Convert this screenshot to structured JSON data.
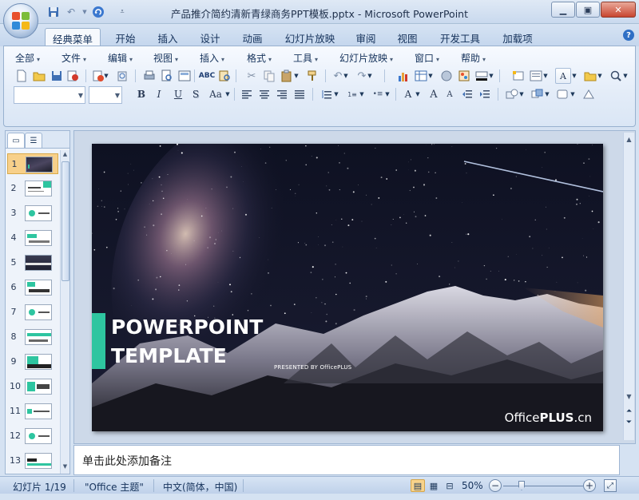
{
  "window": {
    "title": "产品推介简约清新青绿商务PPT模板.pptx - Microsoft PowerPoint",
    "minimize_icon": "minimize-icon",
    "maximize_icon": "maximize-icon",
    "close_icon": "close-icon"
  },
  "quick_access": {
    "save_icon": "save-icon",
    "undo_icon": "undo-icon",
    "redo_icon": "redo-icon",
    "customize_icon": "chevron-down-icon"
  },
  "ribbon_tabs": [
    "经典菜单",
    "开始",
    "插入",
    "设计",
    "动画",
    "幻灯片放映",
    "审阅",
    "视图",
    "开发工具",
    "加载项"
  ],
  "active_tab": "经典菜单",
  "menu_row": [
    "全部",
    "文件",
    "编辑",
    "视图",
    "插入",
    "格式",
    "工具",
    "幻灯片放映",
    "窗口",
    "帮助"
  ],
  "format_labels": {
    "bold": "B",
    "italic": "I",
    "underline": "U",
    "shadow": "S",
    "change_case": "Aa",
    "font_color": "A",
    "grow_font": "A",
    "shrink_font": "A",
    "text_box": "A"
  },
  "slides_pane": {
    "slide_numbers": [
      "1",
      "2",
      "3",
      "4",
      "5",
      "6",
      "7",
      "8",
      "9",
      "10",
      "11",
      "12",
      "13"
    ],
    "selected": "1"
  },
  "slide": {
    "title": "POWERPOINT\nTEMPLATE",
    "presented_by": "PRESENTED BY OfficePLUS",
    "watermark_prefix": "Office",
    "watermark_bold": "PLUS",
    "watermark_suffix": ".cn",
    "accent_color": "#2ec5a0"
  },
  "notes": {
    "placeholder": "单击此处添加备注"
  },
  "status_bar": {
    "slide_info": "幻灯片 1/19",
    "theme": "\"Office 主题\"",
    "language": "中文(简体，中国)",
    "zoom": "50%",
    "zoom_out": "−",
    "zoom_in": "+"
  }
}
